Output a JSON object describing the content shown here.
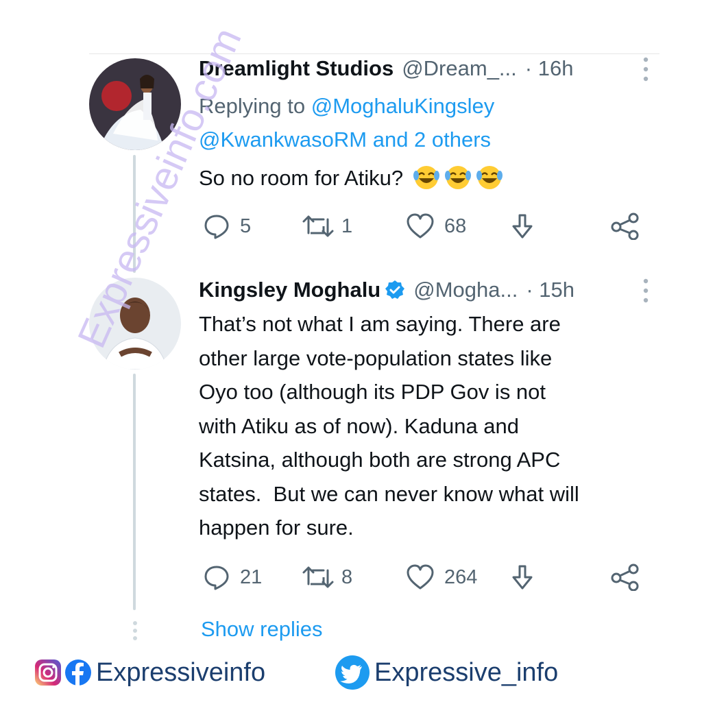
{
  "tweet1": {
    "name": "Dreamlight Studios",
    "handle": "@Dream_...",
    "time": "· 16h",
    "replying_prefix": "Replying to ",
    "replying_mention1": "@MoghaluKingsley",
    "replying_line2_mention": "@KwankwasoRM",
    "replying_line2_rest": " and 2 others",
    "text": "So no room for Atiku?",
    "reply_count": "5",
    "retweet_count": "1",
    "like_count": "68"
  },
  "tweet2": {
    "name": "Kingsley Moghalu",
    "handle": "@Mogha...",
    "time": "· 15h",
    "text_lines": [
      "That’s not what I am saying. There are",
      "other large vote-population states like",
      "Oyo too (although its PDP Gov is not",
      "with Atiku as of now). Kaduna and",
      "Katsina, although both are strong APC",
      "states.  But we can never know what will",
      "happen for sure."
    ],
    "reply_count": "21",
    "retweet_count": "8",
    "like_count": "264"
  },
  "show_replies": "Show replies",
  "watermark": "Expressiveinfo.com",
  "footer": {
    "left_label": "Expressiveinfo",
    "right_label": "Expressive_info"
  },
  "colors": {
    "accent": "#1d9bf0",
    "muted": "#536471",
    "text": "#0f1419",
    "watermark": "#c8b8f2",
    "footer_text": "#1b3e6e"
  },
  "icons": [
    "reply-icon",
    "retweet-icon",
    "like-icon",
    "share-icon",
    "share-network-icon",
    "verified-badge-icon",
    "more-icon",
    "instagram-icon",
    "facebook-icon",
    "twitter-icon",
    "laughing-emoji-icon"
  ]
}
